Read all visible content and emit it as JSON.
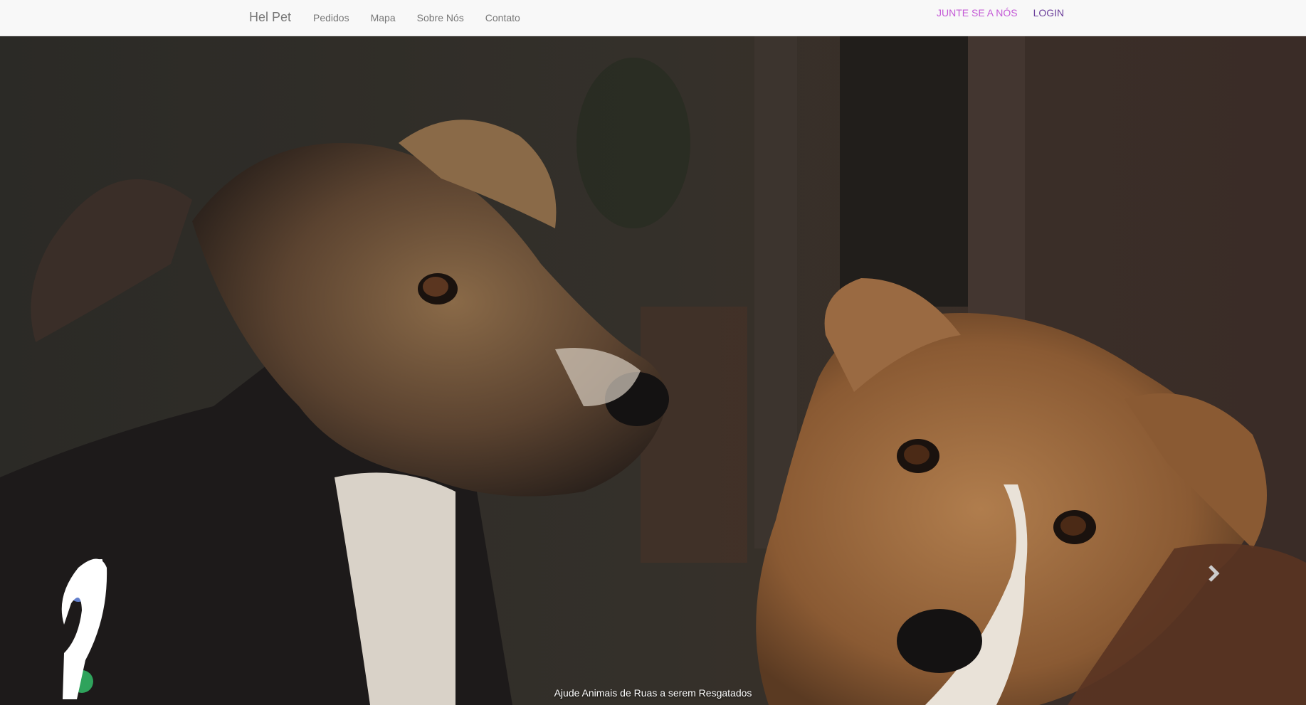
{
  "navbar": {
    "brand": "Hel Pet",
    "links": [
      "Pedidos",
      "Mapa",
      "Sobre Nós",
      "Contato"
    ],
    "join_label": "JUNTE SE A NÓS",
    "login_label": "LOGIN"
  },
  "carousel": {
    "caption": "Ajude Animais de Ruas a serem Resgatados",
    "prev_icon": "chevron-left-icon",
    "next_icon": "chevron-right-icon"
  },
  "colors": {
    "navbar_bg": "#f8f8f8",
    "nav_link": "#777777",
    "join": "#c45ad6",
    "login": "#6a3d9a"
  }
}
